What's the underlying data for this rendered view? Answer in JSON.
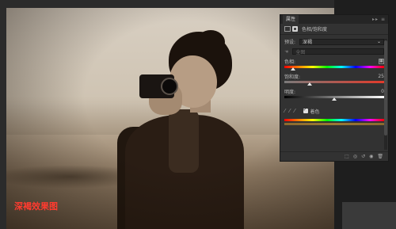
{
  "caption": "深褐效果图",
  "panel": {
    "tab_label": "属性",
    "tab_icons": "▸▸ ≡",
    "title": "色相/饱和度",
    "preset_label": "预设:",
    "preset_value": "深褐",
    "channel_value": "全图",
    "hue_label": "色相:",
    "hue_value": "",
    "saturation_label": "饱和度:",
    "saturation_value": "25",
    "lightness_label": "明度:",
    "lightness_value": "0",
    "colorize_label": "着色",
    "hue_level": 0.09,
    "saturation_level": 0.25,
    "lightness_level": 0.5
  },
  "colors": {
    "caption": "#ff3b2f",
    "panel_bg": "#323232"
  }
}
